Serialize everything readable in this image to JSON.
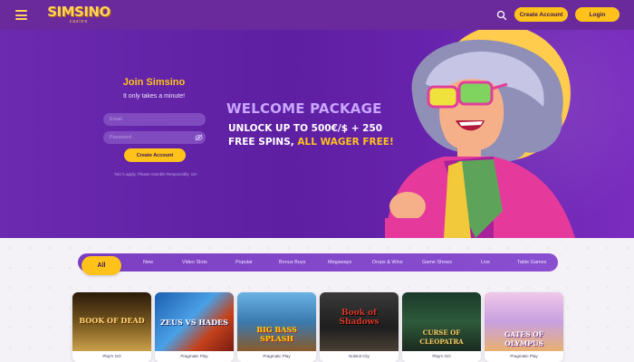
{
  "header": {
    "logo_main": "SIMSINO",
    "logo_sub": "casino",
    "create_account_label": "Create Account",
    "login_label": "Login"
  },
  "join": {
    "title": "Join Simsino",
    "subtitle": "It only takes a minute!",
    "email_placeholder": "Email",
    "password_placeholder": "Password",
    "create_account_label": "Create Account",
    "terms": "T&C's apply. Please Gamble Responsibly. 18+"
  },
  "promo": {
    "title": "WELCOME PACKAGE",
    "line1": "UNLOCK UP TO 500€/$ + 250",
    "line2_prefix": "FREE SPINS, ",
    "line2_highlight": "ALL WAGER FREE!"
  },
  "categories": [
    "All",
    "New",
    "Video Slots",
    "Popular",
    "Bonus Buys",
    "Megaways",
    "Drops & Wins",
    "Game Shows",
    "Live",
    "Table Games"
  ],
  "games": [
    {
      "title": "BOOK OF DEAD",
      "provider": "Play'n GO"
    },
    {
      "title": "ZEUS VS HADES",
      "provider": "Pragmatic Play"
    },
    {
      "title": "BIG BASS SPLASH",
      "provider": "Pragmatic Play"
    },
    {
      "title": "Book of Shadows",
      "provider": "Nolimit City"
    },
    {
      "title": "CURSE OF CLEOPATRA",
      "provider": "Play'n GO"
    },
    {
      "title": "GATES OF OLYMPUS",
      "provider": "Pragmatic Play"
    }
  ],
  "colors": {
    "brand_purple": "#6a2a9c",
    "accent_yellow": "#ffc21b"
  },
  "icons": {
    "menu": "hamburger-icon",
    "search": "search-icon",
    "password_visibility": "eye-icon"
  }
}
